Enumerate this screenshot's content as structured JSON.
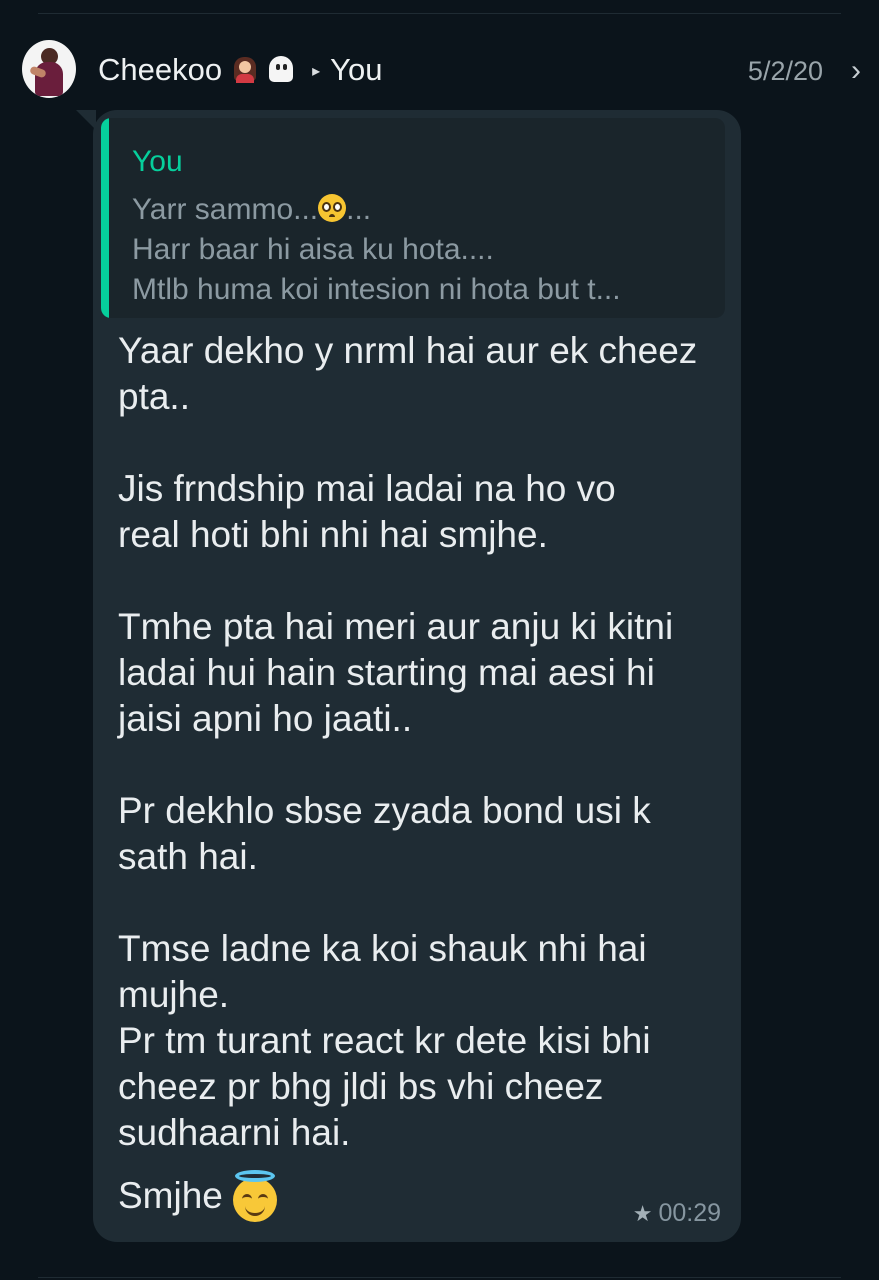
{
  "header": {
    "sender": "Cheekoo",
    "sender_emojis": [
      "woman-emoji",
      "ghost-emoji"
    ],
    "arrow": "▸",
    "recipient": "You",
    "date": "5/2/20",
    "chevron": "›"
  },
  "quote": {
    "author": "You",
    "lines": [
      "Yarr sammo...",
      "...",
      "Harr baar hi aisa ku hota....",
      "Mtlb huma koi intesion ni hota but t..."
    ]
  },
  "message": {
    "paragraphs": [
      [
        "Yaar dekho y nrml hai aur ek cheez",
        "pta.."
      ],
      [
        "Jis frndship mai ladai na ho vo",
        "real hoti bhi nhi hai smjhe."
      ],
      [
        "Tmhe pta hai meri aur anju ki kitni",
        "ladai hui hain starting mai aesi hi",
        "jaisi apni ho jaati.."
      ],
      [
        "Pr dekhlo sbse zyada bond usi k",
        "sath hai."
      ],
      [
        "Tmse ladne ka koi shauk nhi hai",
        "mujhe.",
        "Pr tm turant react kr dete kisi bhi",
        "cheez pr bhg jldi bs vhi cheez",
        "sudhaarni hai.",
        "Smjhe"
      ]
    ]
  },
  "meta": {
    "star": "★",
    "time": "00:29"
  },
  "colors": {
    "background": "#0b141b",
    "bubble": "#1f2c34",
    "quote_accent": "#06cf9c",
    "text": "#e9edef",
    "muted": "#8696a0"
  }
}
